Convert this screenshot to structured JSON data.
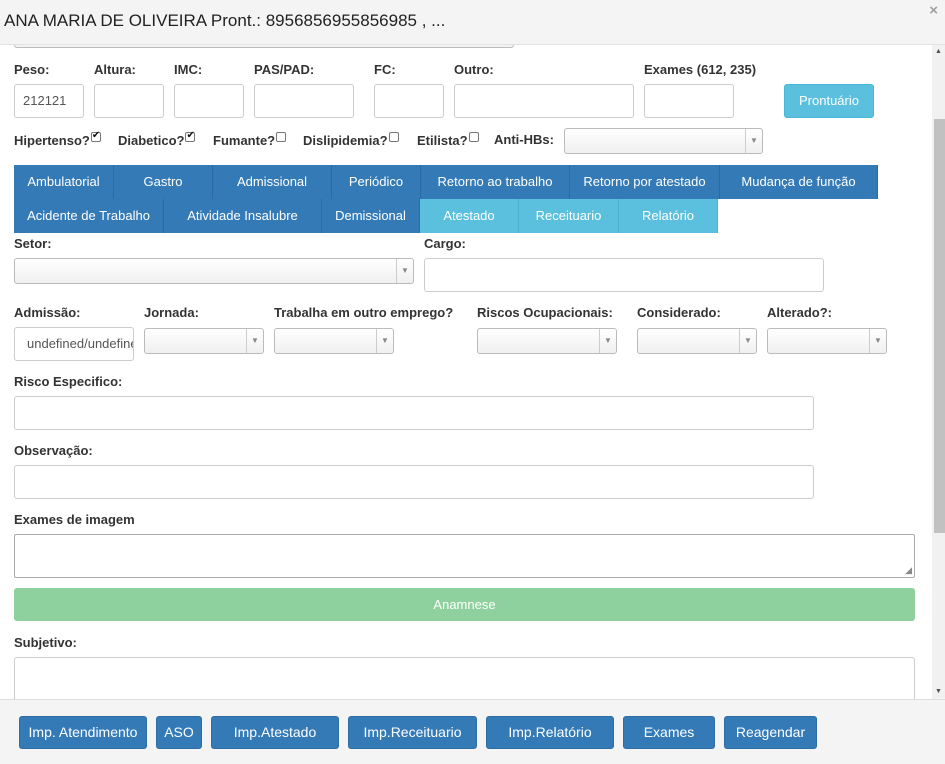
{
  "header": {
    "title": "ANA MARIA DE OLIVEIRA Pront.: 8956856955856985 , ...",
    "close": "×"
  },
  "vitals": {
    "peso_label": "Peso:",
    "peso_value": "212121",
    "altura_label": "Altura:",
    "imc_label": "IMC:",
    "pas_label": "PAS/PAD:",
    "fc_label": "FC:",
    "outro_label": "Outro:",
    "exames_label": "Exames (612, 235)",
    "prontuario_button": "Prontuário"
  },
  "checks": {
    "hipertenso": "Hipertenso?",
    "diabetico": "Diabetico?",
    "fumante": "Fumante?",
    "dislipidemia": "Dislipidemia?",
    "etilista": "Etilista?",
    "antihbs": "Anti-HBs:"
  },
  "tabs": {
    "row1": [
      "Ambulatorial",
      "Gastro",
      "Admissional",
      "Periódico",
      "Retorno ao trabalho",
      "Retorno por atestado",
      "Mudança de função"
    ],
    "row2": [
      "Acidente de Trabalho",
      "Atividade Insalubre",
      "Demissional",
      "Atestado",
      "Receituario",
      "Relatório"
    ]
  },
  "form": {
    "setor_label": "Setor:",
    "cargo_label": "Cargo:",
    "admissao_label": "Admissão:",
    "admissao_value": "undefined/undefined",
    "jornada_label": "Jornada:",
    "outro_emprego_label": "Trabalha em outro emprego?",
    "riscos_label": "Riscos Ocupacionais:",
    "considerado_label": "Considerado:",
    "alterado_label": "Alterado?:",
    "risco_especifico_label": "Risco Especifico:",
    "observacao_label": "Observação:",
    "exames_imagem_label": "Exames de imagem",
    "anamnese_button": "Anamnese",
    "subjetivo_label": "Subjetivo:"
  },
  "footer": {
    "buttons": [
      "Imp. Atendimento",
      "ASO",
      "Imp.Atestado",
      "Imp.Receituario",
      "Imp.Relatório",
      "Exames",
      "Reagendar"
    ]
  },
  "colors": {
    "primary": "#337ab7",
    "info": "#5bc0de",
    "success_light": "#8fd19e"
  }
}
